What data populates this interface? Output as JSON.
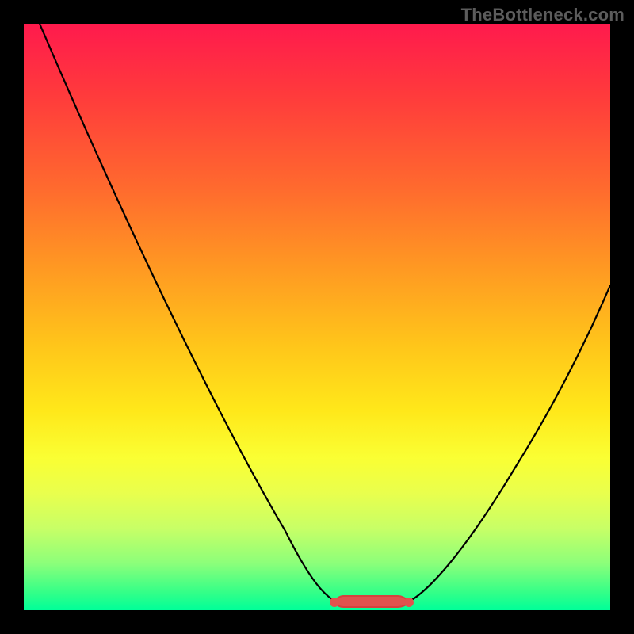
{
  "watermark": {
    "text": "TheBottleneck.com"
  },
  "chart_data": {
    "type": "line",
    "title": "",
    "xlabel": "",
    "ylabel": "",
    "xlim": [
      0,
      100
    ],
    "ylim": [
      0,
      100
    ],
    "series": [
      {
        "name": "bottleneck-curve",
        "x": [
          0,
          8,
          16,
          24,
          32,
          40,
          48,
          52,
          56,
          60,
          64,
          68,
          72,
          80,
          88,
          96,
          100
        ],
        "values": [
          100,
          87,
          73,
          59,
          45,
          31,
          16,
          8,
          2,
          0,
          0,
          2,
          8,
          22,
          36,
          50,
          57
        ]
      }
    ],
    "annotations": [
      {
        "name": "flat-bottom-marker",
        "x_range": [
          54,
          66
        ],
        "y": 0
      }
    ],
    "gradient_stops": [
      {
        "pos": 0,
        "color": "#ff1a4d"
      },
      {
        "pos": 55,
        "color": "#ffc61a"
      },
      {
        "pos": 100,
        "color": "#00ff99"
      }
    ]
  }
}
